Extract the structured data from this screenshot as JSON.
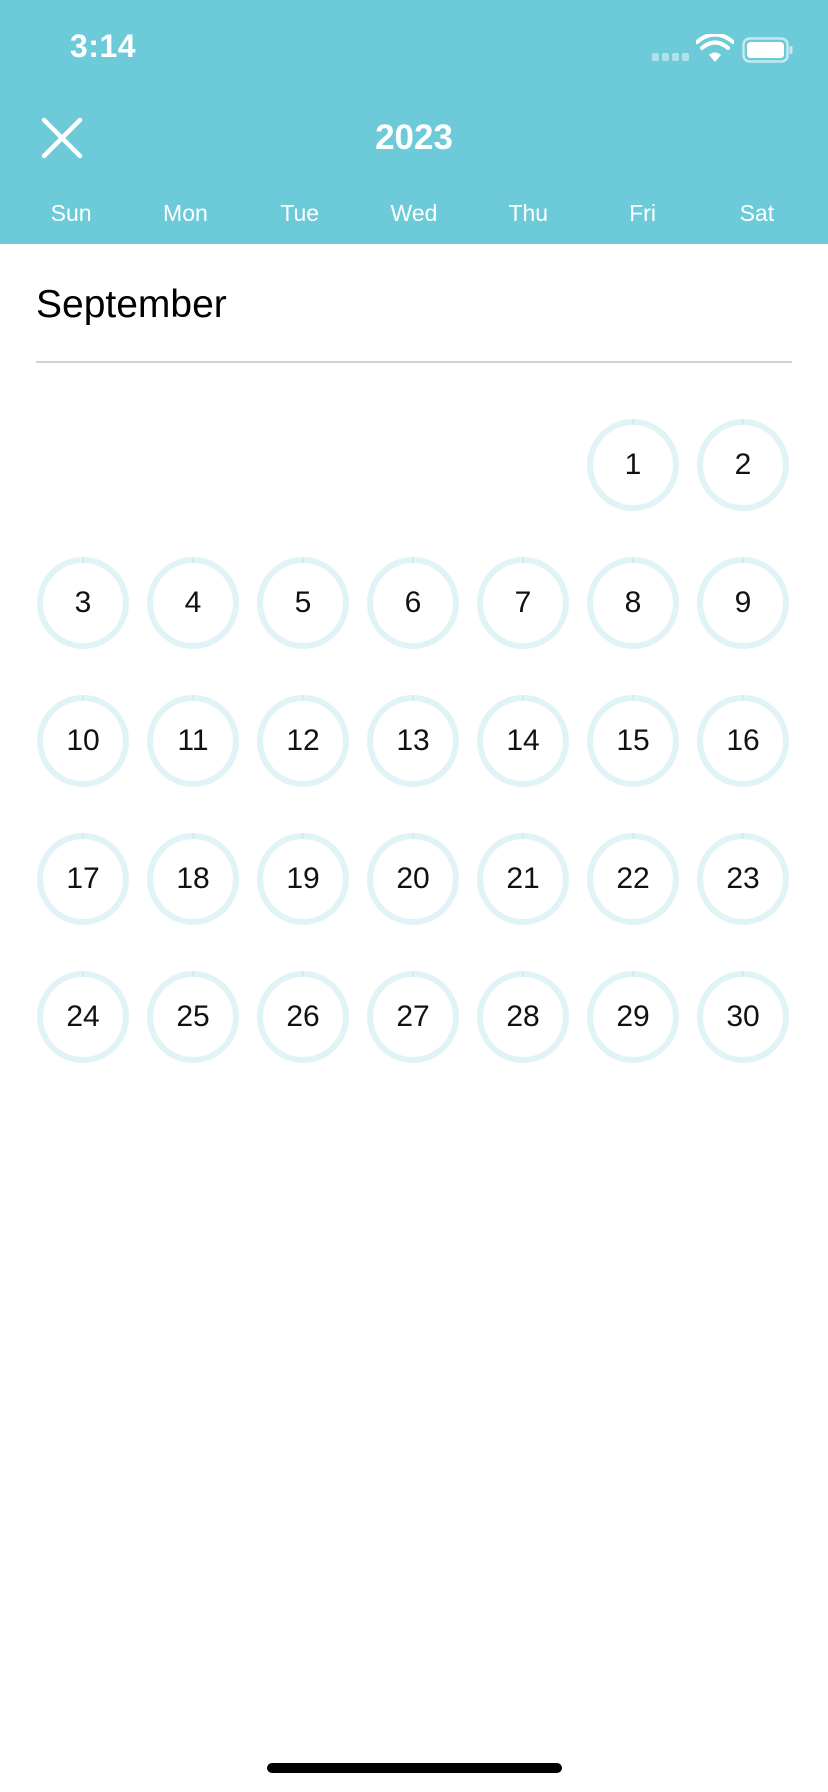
{
  "status_bar": {
    "time": "3:14"
  },
  "header": {
    "year": "2023",
    "weekdays": [
      "Sun",
      "Mon",
      "Tue",
      "Wed",
      "Thu",
      "Fri",
      "Sat"
    ],
    "background_color": "#6ccad9"
  },
  "month": {
    "name": "September",
    "leading_blank_days": 5,
    "days": [
      "1",
      "2",
      "3",
      "4",
      "5",
      "6",
      "7",
      "8",
      "9",
      "10",
      "11",
      "12",
      "13",
      "14",
      "15",
      "16",
      "17",
      "18",
      "19",
      "20",
      "21",
      "22",
      "23",
      "24",
      "25",
      "26",
      "27",
      "28",
      "29",
      "30"
    ],
    "ring_color": "#e0f3f7"
  },
  "icons": {
    "close": "close-icon",
    "wifi": "wifi-icon",
    "battery": "battery-icon",
    "signal": "signal-icon"
  }
}
